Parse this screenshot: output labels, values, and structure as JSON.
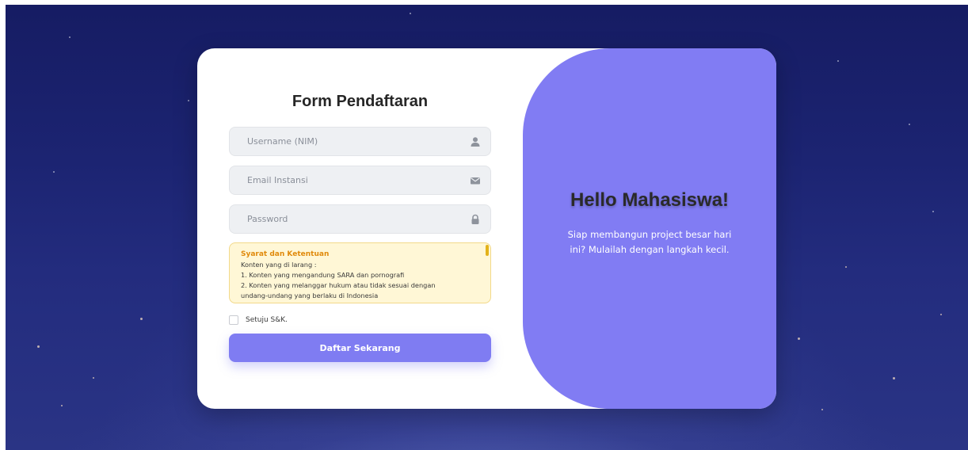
{
  "form": {
    "title": "Form Pendaftaran",
    "username_placeholder": "Username (NIM)",
    "email_placeholder": "Email Instansi",
    "password_placeholder": "Password",
    "terms": {
      "title": "Syarat dan Ketentuan",
      "lines": [
        "Konten yang di larang :",
        "1. Konten yang mengandung SARA dan pornografi",
        "2. Konten yang melanggar hukum atau tidak sesuai dengan",
        "undang-undang yang berlaku di Indonesia"
      ]
    },
    "agree_label": "Setuju S&K.",
    "submit_label": "Daftar Sekarang"
  },
  "panel": {
    "title": "Hello Mahasiswa!",
    "text": "Siap membangun project besar hari ini? Mulailah dengan langkah kecil."
  },
  "icons": {
    "username": "user-icon",
    "email": "envelope-icon",
    "password": "lock-icon"
  },
  "colors": {
    "accent": "#817cf3",
    "terms_background": "#fff7d6",
    "terms_title": "#e08a0c",
    "page_background": "#1c2472"
  }
}
